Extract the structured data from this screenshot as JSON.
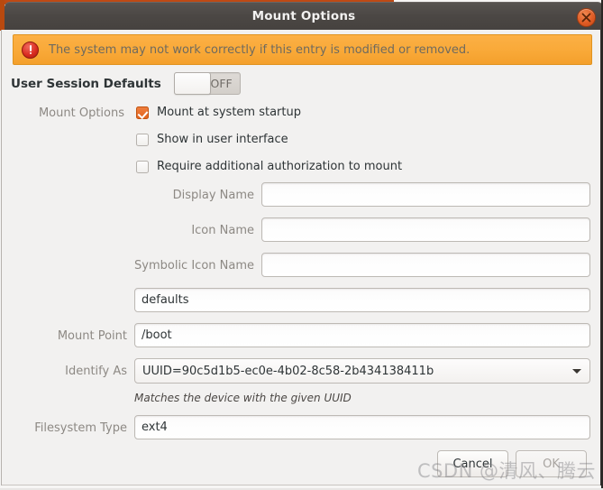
{
  "window": {
    "title": "Mount Options",
    "close_icon": "close-icon"
  },
  "infobar": {
    "icon": "error-icon",
    "message": "The system may not work correctly if this entry is modified or removed."
  },
  "user_session": {
    "label": "User Session Defaults",
    "toggle_state": "OFF"
  },
  "mount_options": {
    "label": "Mount Options",
    "checkboxes": [
      {
        "label": "Mount at system startup",
        "checked": true
      },
      {
        "label": "Show in user interface",
        "checked": false
      },
      {
        "label": "Require additional authorization to mount",
        "checked": false
      }
    ]
  },
  "fields": {
    "display_name": {
      "label": "Display Name",
      "value": "",
      "placeholder": ""
    },
    "icon_name": {
      "label": "Icon Name",
      "value": "",
      "placeholder": ""
    },
    "symbolic_icon_name": {
      "label": "Symbolic Icon Name",
      "value": "",
      "placeholder": ""
    },
    "options": {
      "label": "",
      "value": "defaults",
      "placeholder": ""
    },
    "mount_point": {
      "label": "Mount Point",
      "value": "/boot",
      "placeholder": ""
    },
    "identify_as": {
      "label": "Identify As",
      "value": "UUID=90c5d1b5-ec0e-4b02-8c58-2b434138411b",
      "hint": "Matches the device with the given UUID",
      "arrow_icon": "chevron-down-icon"
    },
    "filesystem_type": {
      "label": "Filesystem Type",
      "value": "ext4",
      "placeholder": ""
    }
  },
  "buttons": {
    "cancel": "Cancel",
    "ok": "OK"
  },
  "watermark": {
    "text": "CSDN @清风、腾云"
  }
}
